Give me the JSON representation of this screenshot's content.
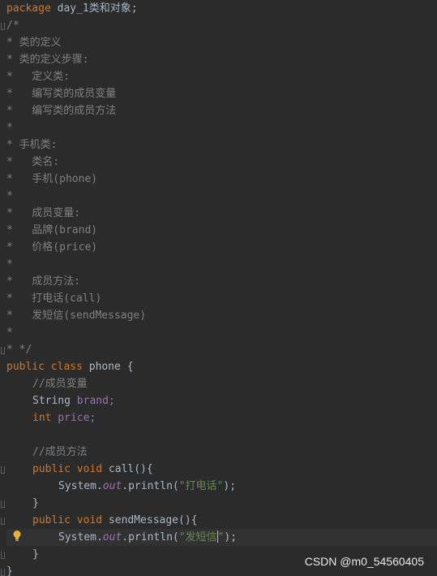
{
  "code": {
    "package_kw": "package",
    "package_name": " day_1类和对象;",
    "comment_open": "/*",
    "comment_lines": [
      "* 类的定义",
      "* 类的定义步骤:",
      "*   定义类:",
      "*   编写类的成员变量",
      "*   编写类的成员方法",
      "*",
      "* 手机类:",
      "*   类名:",
      "*   手机(phone)",
      "*",
      "*   成员变量:",
      "*   品牌(brand)",
      "*   价格(price)",
      "*",
      "*   成员方法:",
      "*   打电话(call)",
      "*   发短信(sendMessage)",
      "*"
    ],
    "comment_close": "* */",
    "class_kw": "public class",
    "class_name": " phone {",
    "member_var_comment": "//成员变量",
    "field1_type": "String",
    "field1_name": " brand;",
    "field2_type": "int",
    "field2_name": " price;",
    "member_method_comment": "//成员方法",
    "method1_kw": "public void",
    "method1_sig": " call(){",
    "stmt1_system": "System.",
    "stmt1_out": "out",
    "stmt1_println": ".println(",
    "stmt1_string": "\"打电话\"",
    "stmt1_end": ");",
    "close_brace_method1": "}",
    "method2_kw": "public void",
    "method2_sig": " sendMessage(){",
    "stmt2_system": "System.",
    "stmt2_out": "out",
    "stmt2_println": ".println(",
    "stmt2_string_a": "\"发短信",
    "stmt2_string_b": "\"",
    "stmt2_end": ");",
    "close_brace_method2": "}",
    "close_brace_class": "}"
  },
  "watermark": "CSDN @m0_54560405",
  "colors": {
    "background": "#2b2b2b",
    "keyword": "#cc7832",
    "comment": "#808080",
    "string": "#6a8759",
    "field": "#9876aa",
    "text": "#a9b7c6"
  },
  "icons": [
    "fold-marker-icon",
    "lightbulb-icon"
  ]
}
